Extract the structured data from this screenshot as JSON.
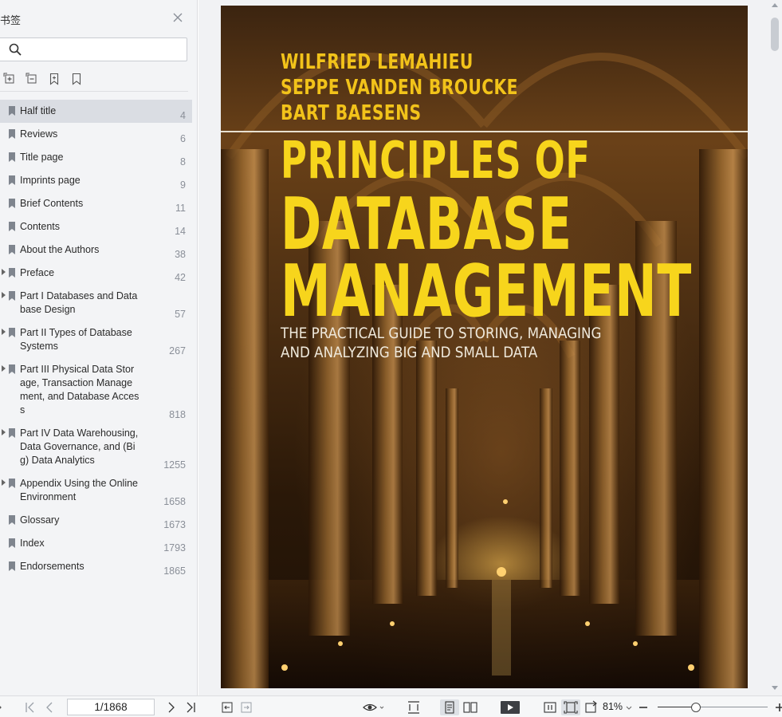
{
  "sidebar": {
    "title": "书签",
    "search": {
      "value": "",
      "placeholder": ""
    },
    "tools": [
      "expand-all-icon",
      "collapse-all-icon",
      "add-bookmark-icon",
      "bookmark-icon"
    ],
    "bookmarks": [
      {
        "label": "Half title",
        "page": "4",
        "expandable": false,
        "selected": true
      },
      {
        "label": "Reviews",
        "page": "6",
        "expandable": false
      },
      {
        "label": "Title page",
        "page": "8",
        "expandable": false
      },
      {
        "label": "Imprints page",
        "page": "9",
        "expandable": false
      },
      {
        "label": "Brief Contents",
        "page": "11",
        "expandable": false
      },
      {
        "label": "Contents",
        "page": "14",
        "expandable": false
      },
      {
        "label": "About the Authors",
        "page": "38",
        "expandable": false
      },
      {
        "label": "Preface",
        "page": "42",
        "expandable": true
      },
      {
        "label": "Part I Databases and Database Design",
        "page": "57",
        "expandable": true
      },
      {
        "label": "Part II Types of Database Systems",
        "page": "267",
        "expandable": true
      },
      {
        "label": "Part III Physical Data Storage, Transaction Management, and Database Access",
        "page": "818",
        "expandable": true
      },
      {
        "label": "Part IV Data Warehousing, Data Governance, and (Big) Data Analytics",
        "page": "1255",
        "expandable": true
      },
      {
        "label": "Appendix Using the Online Environment",
        "page": "1658",
        "expandable": true
      },
      {
        "label": "Glossary",
        "page": "1673",
        "expandable": false
      },
      {
        "label": "Index",
        "page": "1793",
        "expandable": false
      },
      {
        "label": "Endorsements",
        "page": "1865",
        "expandable": false
      }
    ]
  },
  "cover": {
    "authors": [
      "WILFRIED LEMAHIEU",
      "SEPPE VANDEN BROUCKE",
      "BART BAESENS"
    ],
    "title_lines": [
      "PRINCIPLES OF",
      "DATABASE",
      "MANAGEMENT"
    ],
    "subtitle_lines": [
      "THE PRACTICAL GUIDE TO STORING, MANAGING",
      "AND ANALYZING BIG AND SMALL DATA"
    ]
  },
  "toolbar": {
    "page_indicator": "1/1868",
    "zoom": "81%",
    "zoom_fraction": 0.35
  },
  "colors": {
    "sidebar_bg": "#f3f4f6",
    "selected_row": "#dadde3",
    "cover_title": "#f7d51c",
    "cover_author": "#f2c31a"
  }
}
